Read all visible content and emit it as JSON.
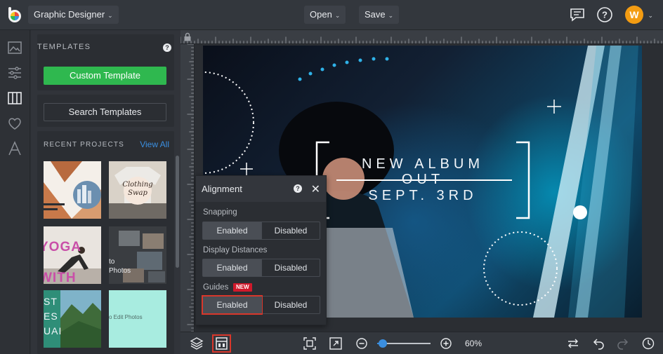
{
  "topbar": {
    "app_title": "Graphic Designer",
    "open_label": "Open",
    "save_label": "Save",
    "avatar_initial": "W",
    "caret": "⌄"
  },
  "templates": {
    "title": "TEMPLATES",
    "help": "?",
    "custom_button": "Custom Template",
    "search_button": "Search Templates",
    "recent_label": "RECENT PROJECTS",
    "view_all": "View All",
    "thumbs": [
      {
        "text": ""
      },
      {
        "text": "Clothing Swap"
      },
      {
        "text": "YOGA WITH SAM"
      },
      {
        "text": "to Photos"
      },
      {
        "text": "ST ES UAI"
      },
      {
        "text": "o Edit Photos"
      }
    ]
  },
  "poster": {
    "line1": "NEW ALBUM",
    "line2": "OUT",
    "line3": "SEPT. 3RD"
  },
  "alignment": {
    "title": "Alignment",
    "help": "?",
    "close": "✕",
    "snapping_label": "Snapping",
    "distances_label": "Display Distances",
    "guides_label": "Guides",
    "new_badge": "NEW",
    "enabled": "Enabled",
    "disabled": "Disabled"
  },
  "bottombar": {
    "zoom_text": "60%",
    "zoom_fraction": 0.1
  },
  "colors": {
    "accent": "#3b8fe0",
    "green": "#2fb84f",
    "highlight": "#d9372b",
    "avatar": "#f39c12"
  }
}
